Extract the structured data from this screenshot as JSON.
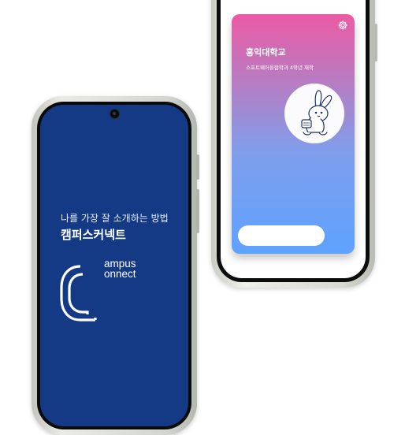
{
  "back_phone": {
    "card": {
      "school_name": "홍익대학교",
      "department_info": "소프트웨어융합학과 4학년 재학",
      "gradient_colors": [
        "#ec5aa4",
        "#5ea2ff"
      ]
    },
    "icons": {
      "settings": "gear-icon",
      "profile": "rabbit-mascot-icon"
    }
  },
  "front_phone": {
    "background_color": "#143a86",
    "tagline": "나를 가장 잘 소개하는 방법",
    "brand_name": "캠퍼스커넥트",
    "logo": {
      "line1": "ampus",
      "line2": "onnect",
      "mark_icon": "c-logo-icon"
    }
  }
}
